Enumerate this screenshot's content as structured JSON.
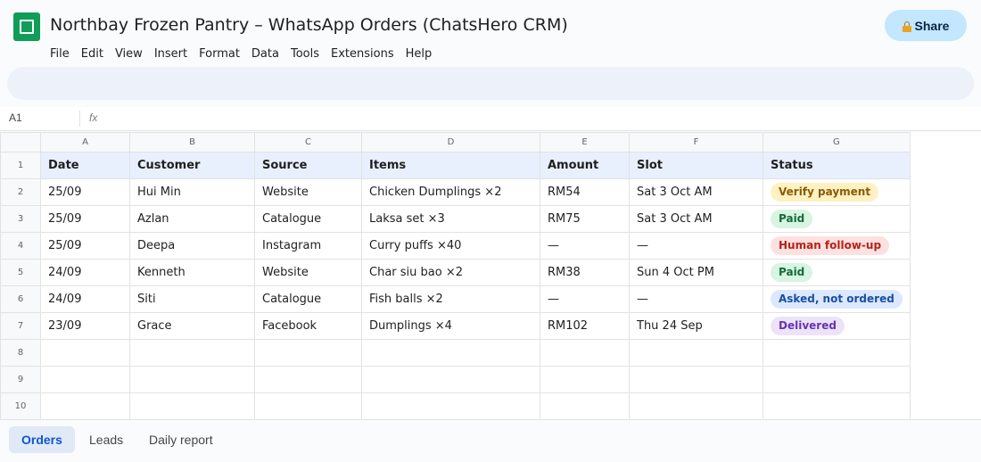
{
  "doc": {
    "title": "Northbay Frozen Pantry – WhatsApp Orders (ChatsHero CRM)",
    "share_label": "Share"
  },
  "menu": [
    "File",
    "Edit",
    "View",
    "Insert",
    "Format",
    "Data",
    "Tools",
    "Extensions",
    "Help"
  ],
  "formula_bar": {
    "cell_ref": "A1",
    "fx_label": "fx"
  },
  "grid": {
    "column_letters": [
      "A",
      "B",
      "C",
      "D",
      "E",
      "F",
      "G"
    ],
    "row_numbers": [
      "1",
      "2",
      "3",
      "4",
      "5",
      "6",
      "7",
      "8",
      "9",
      "10"
    ],
    "headers": [
      "Date",
      "Customer",
      "Source",
      "Items",
      "Amount",
      "Slot",
      "Status"
    ],
    "rows": [
      {
        "date": "25/09",
        "customer": "Hui Min",
        "source": "Website",
        "items": "Chicken Dumplings ×2",
        "amount": "RM54",
        "slot": "Sat 3 Oct AM",
        "status": "Verify payment",
        "status_kind": "verify"
      },
      {
        "date": "25/09",
        "customer": "Azlan",
        "source": "Catalogue",
        "items": "Laksa set ×3",
        "amount": "RM75",
        "slot": "Sat 3 Oct AM",
        "status": "Paid",
        "status_kind": "paid"
      },
      {
        "date": "25/09",
        "customer": "Deepa",
        "source": "Instagram",
        "items": "Curry puffs ×40",
        "amount": "—",
        "slot": "—",
        "status": "Human follow-up",
        "status_kind": "human"
      },
      {
        "date": "24/09",
        "customer": "Kenneth",
        "source": "Website",
        "items": "Char siu bao ×2",
        "amount": "RM38",
        "slot": "Sun 4 Oct PM",
        "status": "Paid",
        "status_kind": "paid"
      },
      {
        "date": "24/09",
        "customer": "Siti",
        "source": "Catalogue",
        "items": "Fish balls ×2",
        "amount": "—",
        "slot": "—",
        "status": "Asked, not ordered",
        "status_kind": "asked"
      },
      {
        "date": "23/09",
        "customer": "Grace",
        "source": "Facebook",
        "items": "Dumplings ×4",
        "amount": "RM102",
        "slot": "Thu 24 Sep",
        "status": "Delivered",
        "status_kind": "delivered"
      }
    ],
    "empty_rows": 3
  },
  "sheet_tabs": [
    {
      "label": "Orders",
      "active": true
    },
    {
      "label": "Leads",
      "active": false
    },
    {
      "label": "Daily report",
      "active": false
    }
  ],
  "colors": {
    "logo_green": "#0f9d58",
    "share_bg": "#c2e7ff",
    "header_row_bg": "#e8f0fe",
    "active_tab_text": "#0b57d0"
  },
  "icons": {
    "logo": "sheets-logo-icon",
    "share": "lock-icon",
    "formula": "fx-icon"
  }
}
